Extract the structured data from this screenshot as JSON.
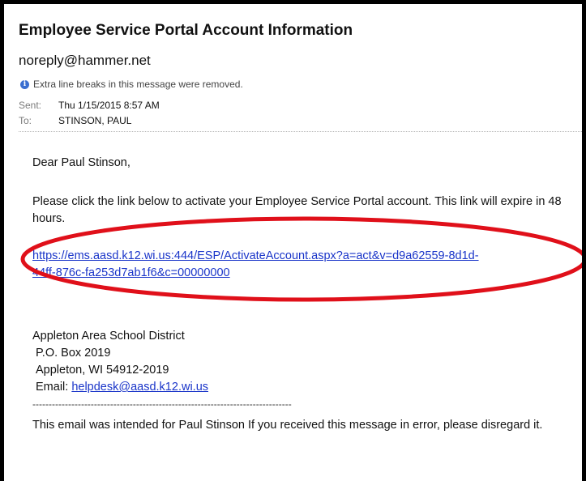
{
  "email": {
    "subject": "Employee Service Portal Account Information",
    "sender": "noreply@hammer.net",
    "info_notice": "Extra line breaks in this message were removed.",
    "sent_label": "Sent:",
    "sent_value": "Thu 1/15/2015 8:57 AM",
    "to_label": "To:",
    "to_value": "STINSON, PAUL"
  },
  "body": {
    "greeting": "Dear Paul Stinson,",
    "paragraph": "Please click the link below to activate your Employee Service Portal account. This link will expire in 48 hours.",
    "link_line1": "https://ems.aasd.k12.wi.us:444/ESP/ActivateAccount.aspx?a=act&v=d9a62559-8d1d-",
    "link_line2": "44ff-876c-fa253d7ab1f6&c=00000000",
    "district_name": "Appleton Area School District",
    "po_box": "P.O. Box 2019",
    "city_state": "Appleton, WI 54912-2019",
    "email_label": "Email: ",
    "email_address": "helpdesk@aasd.k12.wi.us",
    "separator": "--------------------------------------------------------------------------------",
    "footer": "This email was intended for Paul Stinson If you received this message in error, please disregard it."
  },
  "annotation": {
    "ellipse_color": "#e0101a"
  },
  "icons": {
    "info": "info-icon"
  }
}
